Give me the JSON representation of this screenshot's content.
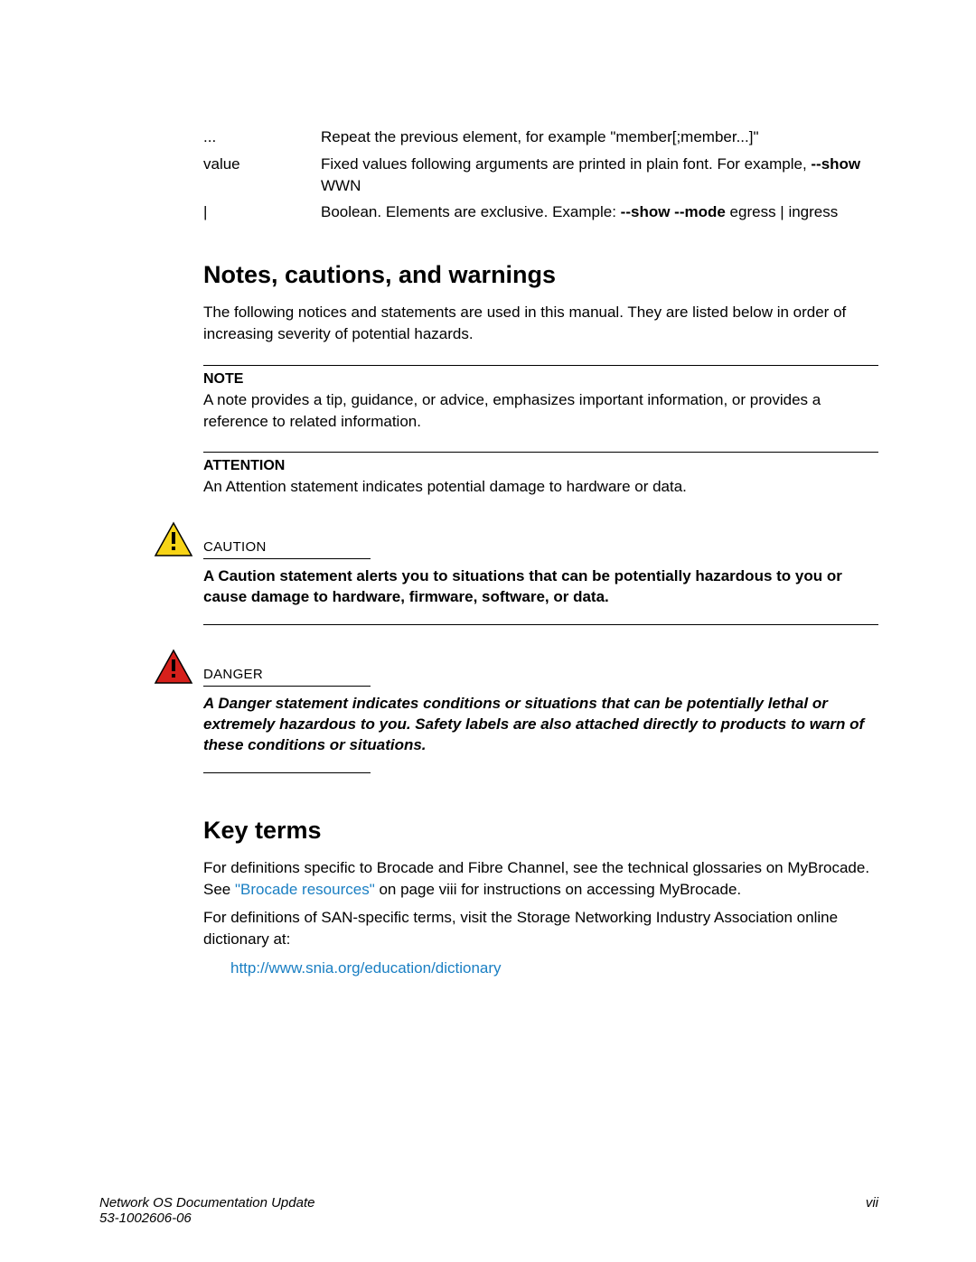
{
  "rows": [
    {
      "left": "...",
      "right": "Repeat the previous element, for example \"member[;member...]\""
    },
    {
      "left": "value",
      "right_prefix": "Fixed values following arguments are printed in plain font. For example, ",
      "bold1": "--show",
      "suffix": " WWN"
    },
    {
      "left": "|",
      "right_prefix": "Boolean. Elements are exclusive. Example: ",
      "bold1": "--show --mode",
      "suffix": " egress | ingress"
    }
  ],
  "section1_title": "Notes, cautions, and warnings",
  "section1_intro": "The following notices and statements are used in this manual. They are listed below in order of increasing severity of potential hazards.",
  "note_label": "NOTE",
  "note_text": "A note provides a tip, guidance, or advice, emphasizes important information, or provides a reference to related information.",
  "attention_label": "ATTENTION",
  "attention_text": "An Attention statement indicates potential damage to hardware or data.",
  "caution_label": "CAUTION",
  "caution_text": "A Caution statement alerts you to situations that can be potentially hazardous to you or cause damage to hardware, firmware, software, or data.",
  "danger_label": "DANGER",
  "danger_text": "A Danger statement indicates conditions or situations that can be potentially lethal or extremely hazardous to you. Safety labels are also attached directly to products to warn of these conditions or situations.",
  "section2_title": "Key terms",
  "keyterms_p1_prefix": "For definitions specific to Brocade and Fibre Channel, see the technical glossaries on MyBrocade. See ",
  "keyterms_p1_link": "\"Brocade resources\"",
  "keyterms_p1_suffix": " on page viii for instructions on accessing MyBrocade.",
  "keyterms_p2": "For definitions of SAN-specific terms, visit the Storage Networking Industry Association online dictionary at:",
  "snia_link": "http://www.snia.org/education/dictionary",
  "footer_title": "Network OS Documentation Update",
  "footer_docnum": "53-1002606-06",
  "footer_page": "vii"
}
